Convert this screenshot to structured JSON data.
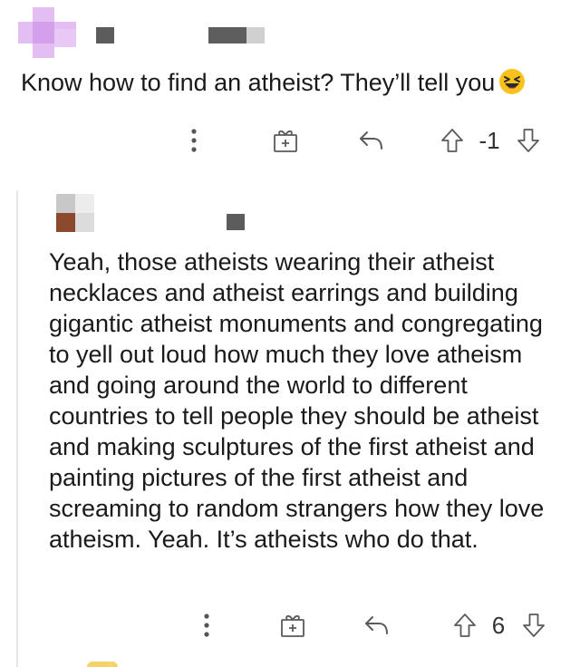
{
  "comment": {
    "text": "Know how to find an atheist? They’ll tell you",
    "emoji_icon": "grinning-squinting-face-icon",
    "score": "-1"
  },
  "reply": {
    "text": "Yeah, those atheists wearing their atheist necklaces and atheist earrings and building gigantic atheist monuments and congregating to yell out loud how much they love atheism and going around the world to different countries to tell people they should be atheist and making sculptures of the first atheist and painting pictures of the first atheist and screaming to random strangers how they love atheism. Yeah. It’s atheists who do that.",
    "score": "6"
  },
  "icons": {
    "more": "more-options-icon",
    "award": "gift-award-icon",
    "reply": "reply-arrow-icon",
    "upvote": "upvote-arrow-icon",
    "downvote": "downvote-arrow-icon"
  },
  "colors": {
    "avatar_top": "#d9a6ee",
    "avatar_reply": "#8b4a2b",
    "redaction": "#5c5c5c",
    "icon": "#6a6a6a"
  }
}
